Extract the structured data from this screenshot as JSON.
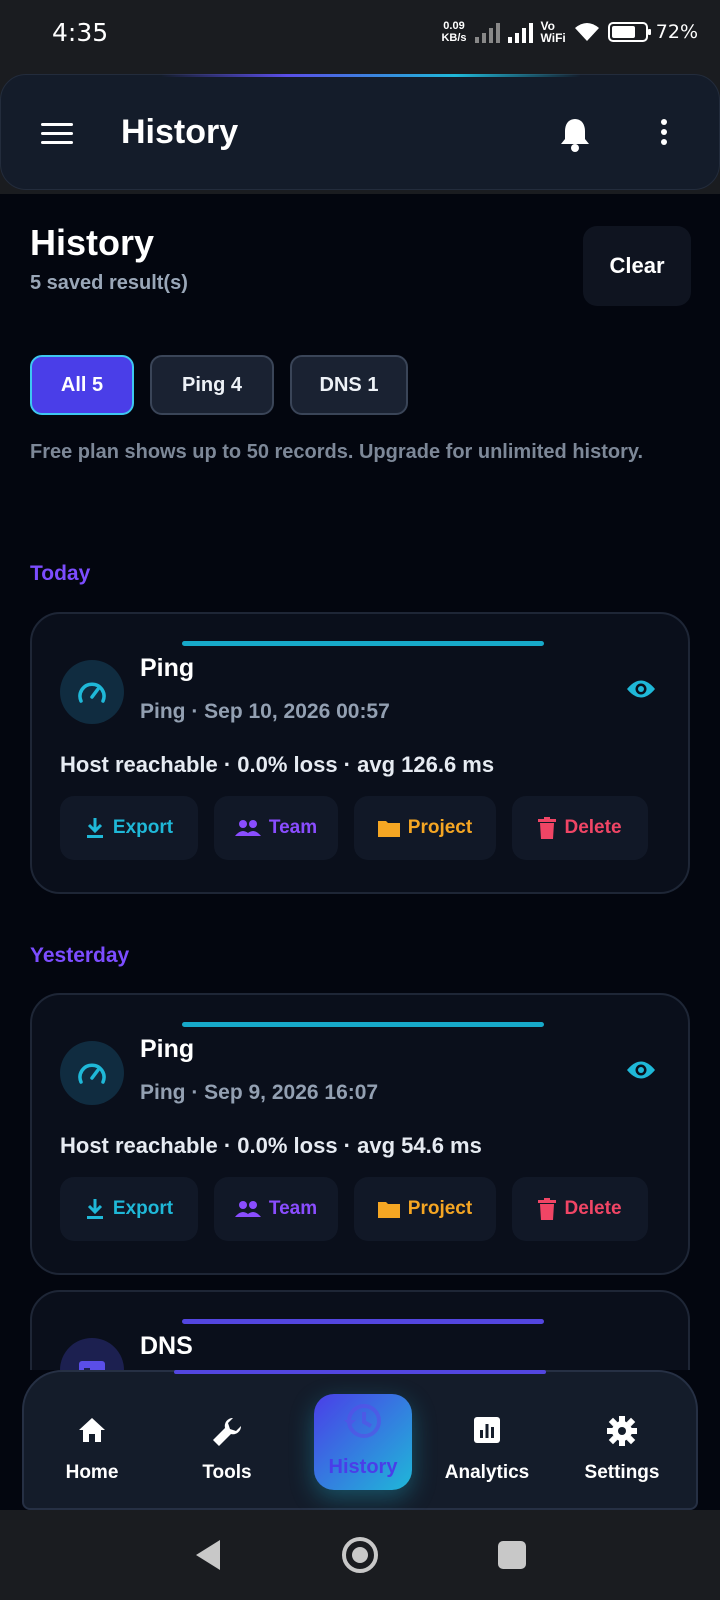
{
  "status_bar": {
    "time": "4:35",
    "net_speed_value": "0.09",
    "net_speed_unit": "KB/s",
    "vowifi_top": "Vo",
    "vowifi_bottom": "WiFi",
    "battery_percent": "72%",
    "battery_level": 0.72
  },
  "app_bar": {
    "title": "History",
    "icons": [
      "menu-icon",
      "bell-icon",
      "more-vert-icon"
    ]
  },
  "header": {
    "title": "History",
    "subtitle": "5 saved result(s)",
    "clear_label": "Clear"
  },
  "filters": [
    {
      "label": "All 5",
      "active": true
    },
    {
      "label": "Ping 4",
      "active": false
    },
    {
      "label": "DNS 1",
      "active": false
    }
  ],
  "plan_note": "Free plan shows up to 50 records. Upgrade for unlimited history.",
  "sections": {
    "today": "Today",
    "yesterday": "Yesterday"
  },
  "colors": {
    "accent_purple": "#7c4dff",
    "accent_cyan": "#1fb8d8",
    "export": "#1fb8d8",
    "team": "#8a4dff",
    "project": "#f5a623",
    "delete": "#f04565"
  },
  "actions": {
    "export": "Export",
    "team": "Team",
    "project": "Project",
    "delete": "Delete"
  },
  "cards": [
    {
      "title": "Ping",
      "meta": "Ping · Sep 10, 2026 00:57",
      "summary": "Host reachable · 0.0% loss · avg 126.6 ms",
      "icon": "speedometer-icon"
    },
    {
      "title": "Ping",
      "meta": "Ping · Sep 9, 2026 16:07",
      "summary": "Host reachable · 0.0% loss · avg 54.6 ms",
      "icon": "speedometer-icon"
    },
    {
      "title": "DNS",
      "icon": "dns-icon"
    }
  ],
  "bottom_nav": [
    {
      "label": "Home",
      "icon": "home-icon"
    },
    {
      "label": "Tools",
      "icon": "wrench-icon"
    },
    {
      "label": "History",
      "icon": "history-icon",
      "active": true
    },
    {
      "label": "Analytics",
      "icon": "analytics-icon"
    },
    {
      "label": "Settings",
      "icon": "gear-icon"
    }
  ]
}
